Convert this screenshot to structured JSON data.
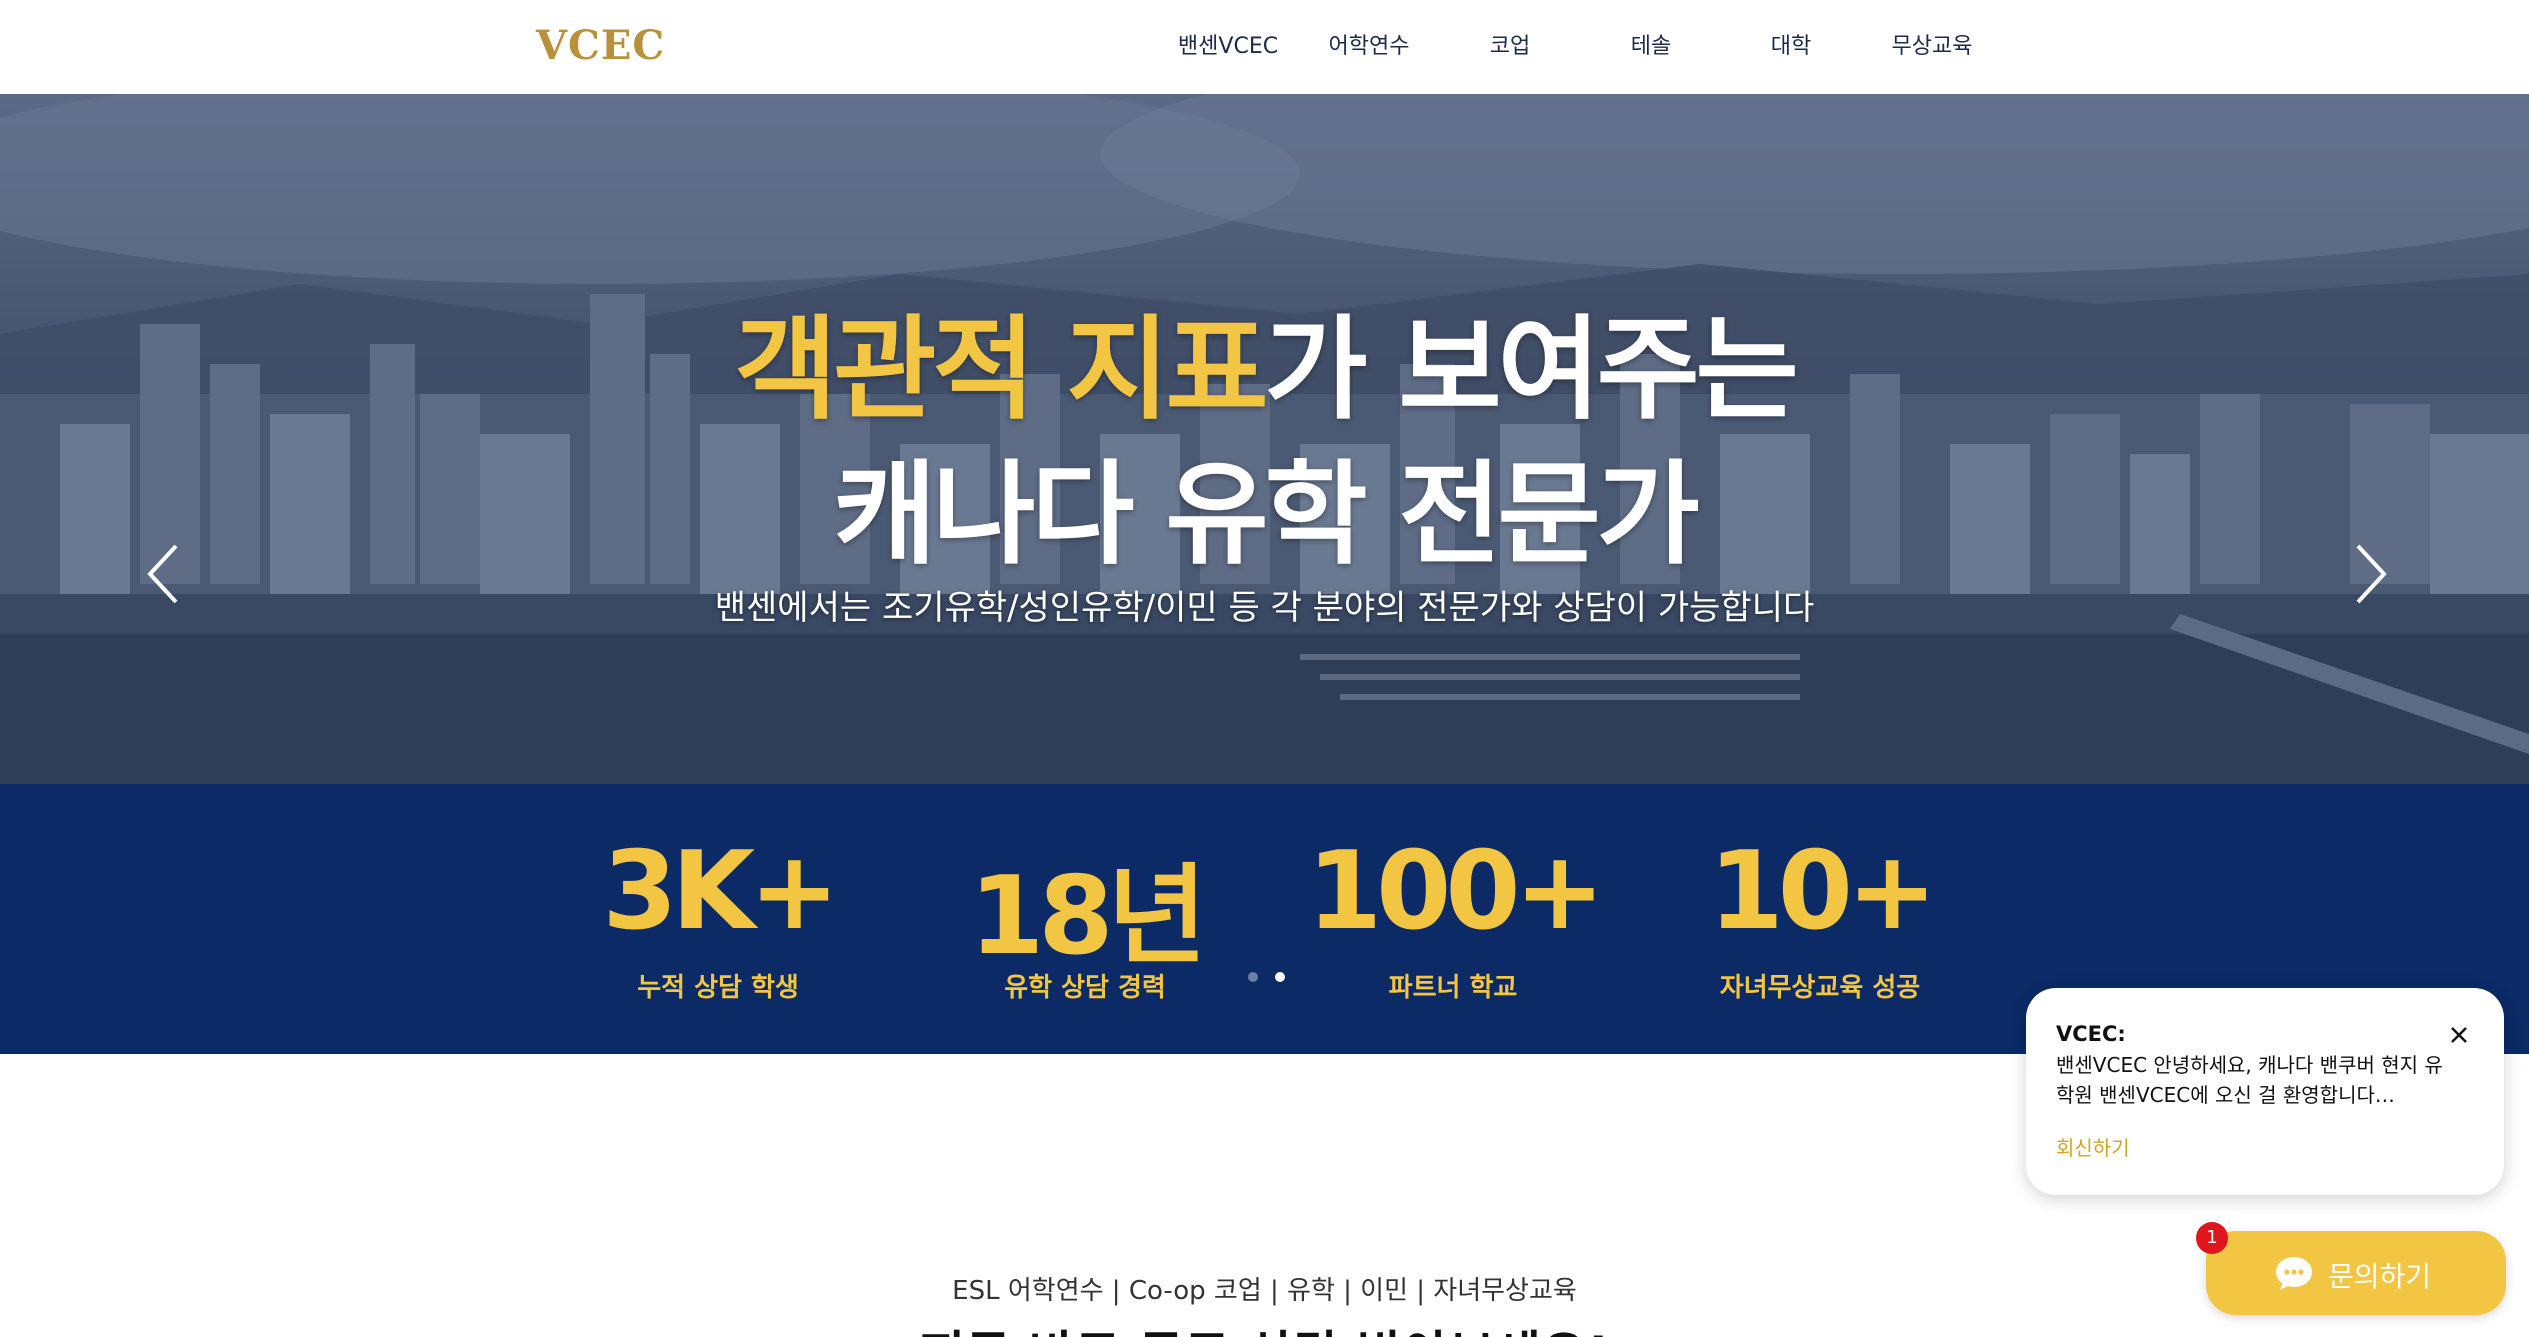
{
  "header": {
    "logo": "VCEC",
    "nav": [
      "밴센VCEC",
      "어학연수",
      "코업",
      "테솔",
      "대학",
      "무상교육"
    ]
  },
  "hero": {
    "title_line1_highlight": "객관적 지표",
    "title_line1_rest": "가 보여주는",
    "title_line2": "캐나다 유학 전문가",
    "subtitle": "밴센에서는 조기유학/성인유학/이민 등 각 분야의 전문가와 상담이 가능합니다",
    "prev_icon": "chevron-left-icon",
    "next_icon": "chevron-right-icon"
  },
  "stats": [
    {
      "value": "3K+",
      "label": "누적 상담 학생"
    },
    {
      "value": "18년",
      "label": "유학 상담 경력"
    },
    {
      "value": "100+",
      "label": "파트너 학교"
    },
    {
      "value": "10+",
      "label": "자녀무상교육 성공"
    }
  ],
  "slider": {
    "count": 2,
    "active_index": 1
  },
  "services": "ESL 어학연수 | Co-op 코업 | 유학 | 이민 | 자녀무상교육",
  "cta_title": "지금 바로 무료 상담 받아보세요!",
  "chat_popup": {
    "sender": "VCEC:",
    "message": "밴센VCEC 안녕하세요, 캐나다 밴쿠버 현지 유학원 밴센VCEC에 오신 걸 환영합니다…",
    "reply": "회신하기",
    "close_icon": "close-icon"
  },
  "chat_button": {
    "label": "문의하기",
    "badge": "1",
    "icon": "chat-bubble-icon"
  },
  "colors": {
    "navy": "#0b2a66",
    "gold": "#f2c542",
    "logo_gold": "#b8913a"
  }
}
